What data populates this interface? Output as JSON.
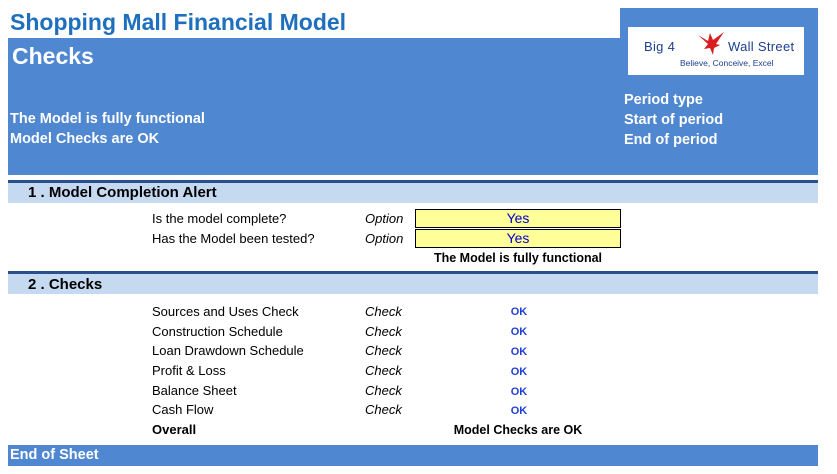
{
  "header": {
    "app_title": "Shopping Mall Financial Model",
    "sheet_title": "Checks",
    "model_status": "The Model is fully functional",
    "checks_status": "Model Checks are OK",
    "period_labels": [
      "Period type",
      "Start of period",
      "End of period"
    ]
  },
  "logo": {
    "main_left": "Big 4",
    "main_right": "Wall Street",
    "tagline": "Believe, Conceive, Excel",
    "icon": "eagle-icon",
    "color": "#1a3f8f"
  },
  "colors": {
    "title_blue": "#1f6fbf",
    "header_blue": "#4f87d1",
    "section_band": "#c5d9f1",
    "divider": "#2b4f8c",
    "option_fill": "#ffff99",
    "ok_text": "#1f3fd6"
  },
  "section1": {
    "title": "1 . Model Completion Alert",
    "rows": [
      {
        "label": "Is the model complete?",
        "type": "Option",
        "value": "Yes"
      },
      {
        "label": "Has the Model been tested?",
        "type": "Option",
        "value": "Yes"
      }
    ],
    "summary": "The Model is fully functional"
  },
  "section2": {
    "title": "2 . Checks",
    "rows": [
      {
        "label": "Sources and Uses Check",
        "type": "Check",
        "value": "OK"
      },
      {
        "label": "Construction Schedule",
        "type": "Check",
        "value": "OK"
      },
      {
        "label": "Loan Drawdown Schedule",
        "type": "Check",
        "value": "OK"
      },
      {
        "label": "Profit & Loss",
        "type": "Check",
        "value": "OK"
      },
      {
        "label": "Balance Sheet",
        "type": "Check",
        "value": "OK"
      },
      {
        "label": "Cash Flow",
        "type": "Check",
        "value": "OK"
      }
    ],
    "overall_label": "Overall",
    "overall_value": "Model Checks are OK"
  },
  "footer": {
    "text": "End of Sheet"
  }
}
